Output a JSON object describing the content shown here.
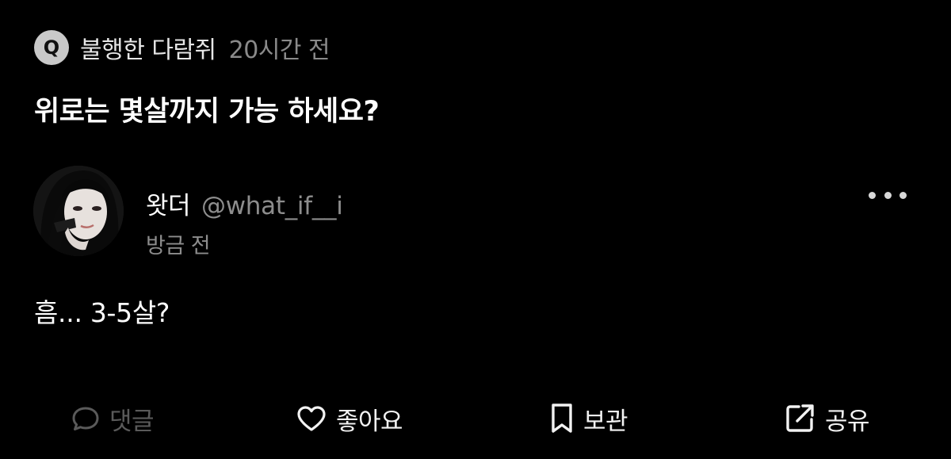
{
  "question": {
    "badge": "Q",
    "asker": "불행한 다람쥐",
    "time": "20시간 전",
    "text": "위로는 몇살까지 가능 하세요?"
  },
  "answer": {
    "name": "왓더",
    "handle": "@what_if__i",
    "time": "방금 전",
    "text": "흠... 3-5살?"
  },
  "actions": {
    "comment": "댓글",
    "like": "좋아요",
    "save": "보관",
    "share": "공유"
  },
  "icons": {
    "comment": "speech-bubble-icon",
    "like": "heart-icon",
    "save": "bookmark-icon",
    "share": "share-external-icon",
    "more": "more-horizontal-icon"
  },
  "colors": {
    "background": "#000000",
    "primary_text": "#ffffff",
    "secondary_text": "#8d8d8d",
    "disabled": "#5a5a5a"
  }
}
